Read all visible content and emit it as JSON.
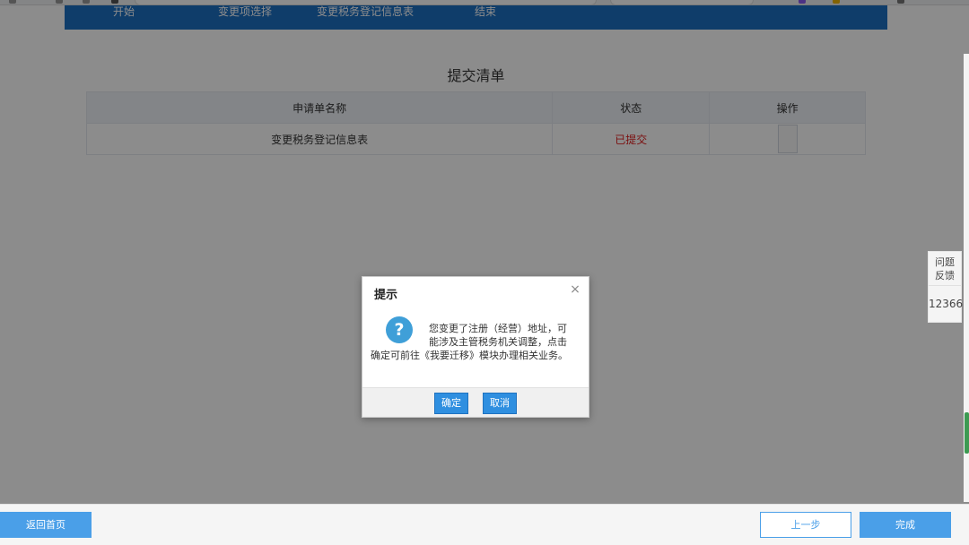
{
  "steps": [
    "开始",
    "变更项选择",
    "变更税务登记信息表",
    "结束"
  ],
  "panel": {
    "title": "提交清单",
    "table": {
      "headers": [
        "申请单名称",
        "状态",
        "操作"
      ],
      "rows": [
        {
          "name": "变更税务登记信息表",
          "status": "已提交"
        }
      ]
    }
  },
  "side": {
    "feedback_line1": "问题",
    "feedback_line2": "反馈",
    "hotline": "12366"
  },
  "dialog": {
    "title": "提示",
    "close_symbol": "×",
    "icon_symbol": "?",
    "message": "您变更了注册（经营）地址，可能涉及主管税务机关调整，点击确定可前往《我要迁移》模块办理相关业务。",
    "ok_label": "确定",
    "cancel_label": "取消"
  },
  "bottom": {
    "home_label": "返回首页",
    "prev_label": "上一步",
    "finish_label": "完成"
  },
  "colors": {
    "step_bar": "#1d6fc1",
    "status_submitted": "#e02020",
    "primary_button": "#4a9fe8",
    "dialog_button": "#2f8fe0",
    "question_icon": "#3f9fd8"
  }
}
